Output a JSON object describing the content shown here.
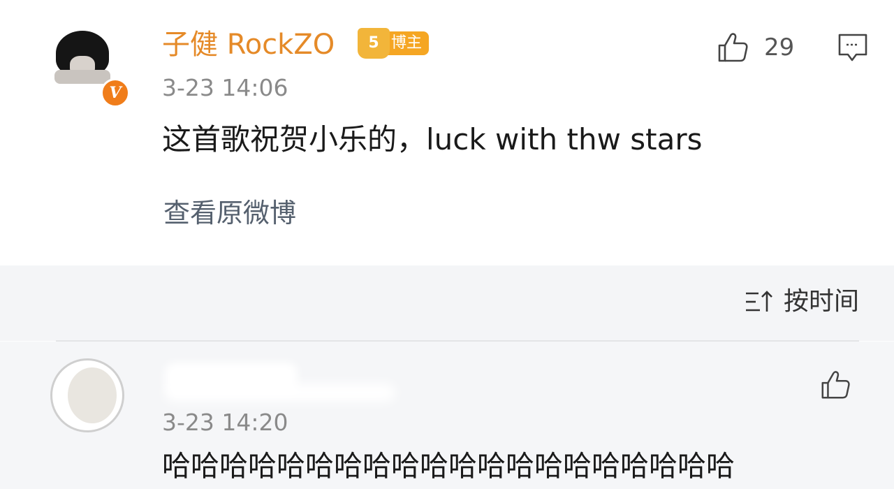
{
  "post": {
    "username": "子健 RockZO",
    "verified_badge": "V",
    "rank_badge": {
      "level": "5",
      "label": "博主",
      "color": "#f5a623"
    },
    "timestamp": "3-23 14:06",
    "comment": "这首歌祝贺小乐的，luck with thw stars",
    "view_original": "查看原微博",
    "like_count": "29",
    "username_color": "#e58a28",
    "icons": {
      "like": "thumbs-up-icon",
      "reply": "comment-bubble-icon"
    }
  },
  "sort": {
    "label": "按时间",
    "icon": "sort-icon"
  },
  "reply": {
    "timestamp": "3-23 14:20",
    "comment": "哈哈哈哈哈哈哈哈哈哈哈哈哈哈哈哈哈哈哈哈",
    "icons": {
      "like": "thumbs-up-icon"
    }
  }
}
